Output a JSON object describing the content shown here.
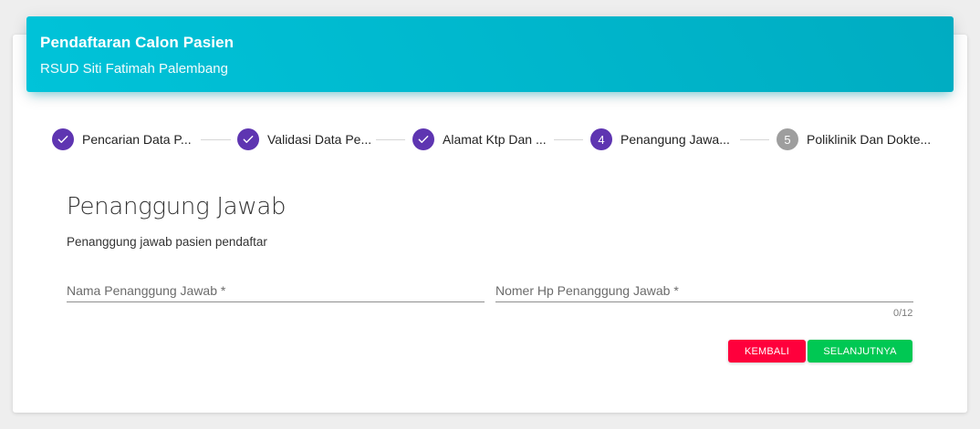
{
  "header": {
    "title": "Pendaftaran Calon Pasien",
    "subtitle": "RSUD Siti Fatimah Palembang"
  },
  "stepper": {
    "steps": [
      {
        "label": "Pencarian Data P...",
        "number": "1",
        "status": "completed"
      },
      {
        "label": "Validasi Data Pe...",
        "number": "2",
        "status": "completed"
      },
      {
        "label": "Alamat Ktp Dan ...",
        "number": "3",
        "status": "completed"
      },
      {
        "label": "Penangung Jawa...",
        "number": "4",
        "status": "active"
      },
      {
        "label": "Poliklinik Dan Dokte...",
        "number": "5",
        "status": "pending"
      }
    ],
    "colors": {
      "completed": "#5e35b1",
      "active": "#5e35b1",
      "pending": "#9e9e9e"
    }
  },
  "form": {
    "title": "Penanggung Jawab",
    "description": "Penanggung jawab pasien pendaftar",
    "name_field": {
      "value": "",
      "placeholder": "Nama Penanggung Jawab *"
    },
    "phone_field": {
      "value": "",
      "placeholder": "Nomer Hp Penanggung Jawab *",
      "counter": "0/12"
    }
  },
  "actions": {
    "back_label": "KEMBALI",
    "back_color": "#ff003c",
    "next_label": "SELANJUTNYA",
    "next_color": "#00c853"
  }
}
